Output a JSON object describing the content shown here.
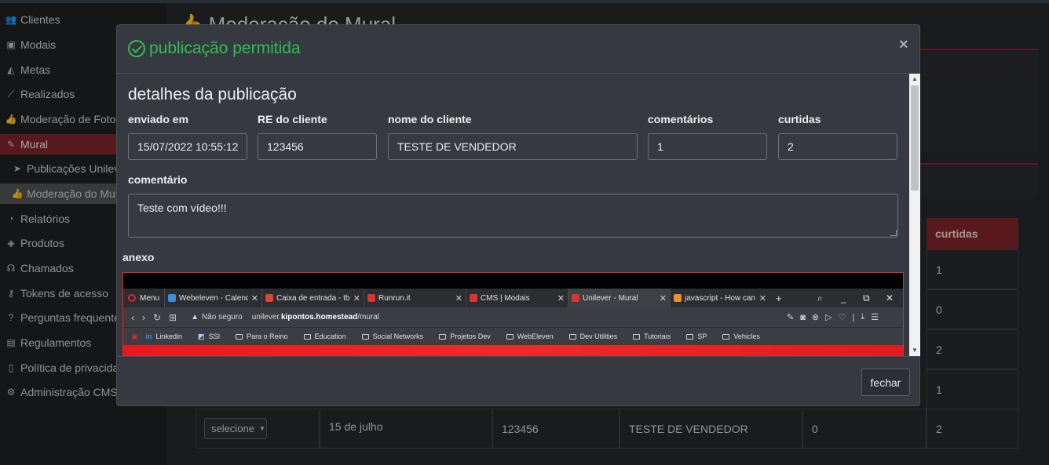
{
  "sidebar": {
    "items": [
      {
        "label": "Clientes",
        "icon": "users-icon"
      },
      {
        "label": "Modais",
        "icon": "box-icon"
      },
      {
        "label": "Metas",
        "icon": "area-chart-icon"
      },
      {
        "label": "Realizados",
        "icon": "line-chart-icon"
      },
      {
        "label": "Moderação de Fotos",
        "icon": "thumbs-up-icon"
      },
      {
        "label": "Mural",
        "icon": "edit-icon"
      },
      {
        "label": "Publicações Unilever",
        "icon": "paper-plane-icon"
      },
      {
        "label": "Moderação do Mural",
        "icon": "thumbs-up-icon"
      },
      {
        "label": "Relatórios",
        "icon": "pie-chart-icon"
      },
      {
        "label": "Produtos",
        "icon": "tags-icon"
      },
      {
        "label": "Chamados",
        "icon": "headset-icon"
      },
      {
        "label": "Tokens de acesso",
        "icon": "key-icon"
      },
      {
        "label": "Perguntas frequentes",
        "icon": "question-icon"
      },
      {
        "label": "Regulamentos",
        "icon": "file-icon"
      },
      {
        "label": "Política de privacidade",
        "icon": "bookmark-icon"
      },
      {
        "label": "Administração CMS",
        "icon": "cogs-icon"
      }
    ]
  },
  "page": {
    "title": "Moderação do Mural"
  },
  "table": {
    "curtidas_header": "curtidas",
    "curtidas_values": [
      "1",
      "0",
      "2",
      "1",
      "2"
    ],
    "last_row": {
      "select_label": "selecione",
      "date": "15 de julho",
      "re": "123456",
      "name": "TESTE DE VENDEDOR",
      "comments": "0",
      "likes": "2"
    }
  },
  "modal": {
    "title": "publicação permitida",
    "close_symbol": "×",
    "section_title": "detalhes da publicação",
    "fields": {
      "sent_label": "enviado em",
      "sent_value": "15/07/2022 10:55:12",
      "re_label": "RE do cliente",
      "re_value": "123456",
      "name_label": "nome do cliente",
      "name_value": "TESTE DE VENDEDOR",
      "comments_label": "comentários",
      "comments_value": "1",
      "likes_label": "curtidas",
      "likes_value": "2"
    },
    "comment_label": "comentário",
    "comment_value": "Teste com vídeo!!!",
    "attachment_label": "anexo",
    "close_button": "fechar"
  },
  "attachment": {
    "menu": "Menu",
    "tabs": [
      {
        "label": "Webeleven - Calendar",
        "color": "#3c8cd8"
      },
      {
        "label": "Caixa de entrada - tbar",
        "color": "#d8442f"
      },
      {
        "label": "Runrun.it",
        "color": "#d8352f"
      },
      {
        "label": "CMS | Modais",
        "color": "#d8352f"
      },
      {
        "label": "Unilever - Mural",
        "color": "#d8352f"
      },
      {
        "label": "javascript - How can I s",
        "color": "#e8902a"
      }
    ],
    "plus": "+",
    "not_secure": "Não seguro",
    "url_prefix": "unilever.",
    "url_domain": "kipontos.homestead",
    "url_path": "/mural",
    "bookmarks": [
      "Linkedin",
      "SSI",
      "Para o Reino",
      "Education",
      "Social Networks",
      "Projetos Dev",
      "WebEleven",
      "Dev Utilities",
      "Tutoriais",
      "SP",
      "Vehicles"
    ]
  }
}
